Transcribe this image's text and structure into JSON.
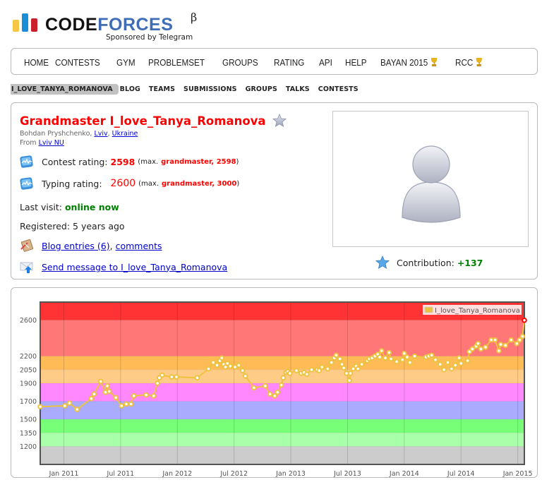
{
  "logo": {
    "word_part1": "CODE",
    "word_part2": "FORCES",
    "beta": "β",
    "sponsor": "Sponsored by Telegram"
  },
  "main_menu": [
    {
      "label": "HOME"
    },
    {
      "label": "CONTESTS"
    },
    {
      "label": "GYM"
    },
    {
      "label": "PROBLEMSET"
    },
    {
      "label": "GROUPS"
    },
    {
      "label": "RATING"
    },
    {
      "label": "API"
    },
    {
      "label": "HELP"
    },
    {
      "label": "BAYAN 2015",
      "icon": "trophy-icon"
    },
    {
      "label": "RCC",
      "icon": "trophy-icon"
    }
  ],
  "sub_menu": [
    {
      "label": "I_LOVE_TANYA_ROMANOVA",
      "active": true
    },
    {
      "label": "BLOG"
    },
    {
      "label": "TEAMS"
    },
    {
      "label": "SUBMISSIONS"
    },
    {
      "label": "GROUPS"
    },
    {
      "label": "TALKS"
    },
    {
      "label": "CONTESTS"
    }
  ],
  "profile": {
    "rank": "Grandmaster",
    "handle": "I_love_Tanya_Romanova",
    "handle_color": "#ff0000",
    "favorite_icon": "star-icon",
    "full_name": "Bohdan Pryshchenko",
    "city": "Lviv",
    "country": "Ukraine",
    "from_label": "From",
    "organization": "Lviv NU",
    "contest_rating": {
      "label": "Contest rating:",
      "value": "2598",
      "max_prefix": "(max.",
      "max_rank": "grandmaster, 2598",
      "max_suffix": ")",
      "icon": "rating-chart-icon"
    },
    "typing_rating": {
      "label": "Typing rating:",
      "value": "2600",
      "max_prefix": "(max.",
      "max_rank": "grandmaster, 3000",
      "max_suffix": ")",
      "icon": "rating-chart-icon"
    },
    "last_visit": {
      "label": "Last visit:",
      "value": "online now"
    },
    "registered": {
      "label": "Registered:",
      "value": "5 years ago"
    },
    "blog": {
      "entries_link": "Blog entries (6)",
      "separator": ",",
      "comments_link": "comments",
      "icon": "blog-icon"
    },
    "message": {
      "link": "Send message to I_love_Tanya_Romanova",
      "icon": "send-message-icon"
    },
    "avatar_icon": "user-avatar-icon",
    "contribution": {
      "label": "Contribution:",
      "value": "+137",
      "icon": "contribution-star-icon"
    }
  },
  "colors": {
    "grandmaster": "#ff0000",
    "online": "#008000",
    "link": "#0000cc",
    "series": "#edc240"
  },
  "chart_data": {
    "type": "line",
    "title": "",
    "xlabel": "",
    "ylabel": "",
    "legend": {
      "label": "I_love_Tanya_Romanova",
      "placement": "top-right"
    },
    "x_unit": "months since Jan 2011",
    "xlim": [
      -2.5,
      48.7
    ],
    "ylim": [
      1000,
      2800
    ],
    "x_ticks": [
      {
        "label": "Jan 2011",
        "value": 0
      },
      {
        "label": "Jul 2011",
        "value": 6
      },
      {
        "label": "Jan 2012",
        "value": 12
      },
      {
        "label": "Jul 2012",
        "value": 18
      },
      {
        "label": "Jan 2013",
        "value": 24
      },
      {
        "label": "Jul 2013",
        "value": 30
      },
      {
        "label": "Jan 2014",
        "value": 36
      },
      {
        "label": "Jul 2014",
        "value": 42
      },
      {
        "label": "Jan 2015",
        "value": 48
      }
    ],
    "y_ticks": [
      1200,
      1350,
      1500,
      1700,
      1900,
      2050,
      2200,
      2600
    ],
    "grid": true,
    "bands": [
      {
        "from": 2600,
        "to": 2800,
        "color": "#ff3333"
      },
      {
        "from": 2200,
        "to": 2600,
        "color": "#ff7777"
      },
      {
        "from": 2050,
        "to": 2200,
        "color": "#ffbb55"
      },
      {
        "from": 1900,
        "to": 2050,
        "color": "#ffcc88"
      },
      {
        "from": 1700,
        "to": 1900,
        "color": "#ff88ff"
      },
      {
        "from": 1500,
        "to": 1700,
        "color": "#aaaaff"
      },
      {
        "from": 1350,
        "to": 1500,
        "color": "#77ff77"
      },
      {
        "from": 1200,
        "to": 1350,
        "color": "#aaffaa"
      },
      {
        "from": 1000,
        "to": 1200,
        "color": "#cccccc"
      }
    ],
    "series": [
      {
        "name": "I_love_Tanya_Romanova",
        "color": "#edc240",
        "points": [
          [
            -2.5,
            1640
          ],
          [
            0.1,
            1650
          ],
          [
            0.6,
            1680
          ],
          [
            1.4,
            1610
          ],
          [
            2.9,
            1730
          ],
          [
            3.2,
            1780
          ],
          [
            3.9,
            1920
          ],
          [
            4.4,
            1800
          ],
          [
            4.6,
            1870
          ],
          [
            4.8,
            1810
          ],
          [
            5.5,
            1740
          ],
          [
            6.1,
            1650
          ],
          [
            6.6,
            1670
          ],
          [
            7.1,
            1670
          ],
          [
            7.4,
            1760
          ],
          [
            8.7,
            1770
          ],
          [
            9.5,
            1760
          ],
          [
            9.9,
            1900
          ],
          [
            10.1,
            1960
          ],
          [
            10.4,
            1990
          ],
          [
            11.4,
            1970
          ],
          [
            11.9,
            1970
          ],
          [
            14.1,
            1960
          ],
          [
            15.3,
            2060
          ],
          [
            15.8,
            2130
          ],
          [
            16.2,
            2100
          ],
          [
            16.5,
            2150
          ],
          [
            16.7,
            2180
          ],
          [
            16.9,
            2110
          ],
          [
            17.1,
            2080
          ],
          [
            17.3,
            2120
          ],
          [
            17.6,
            2090
          ],
          [
            18.1,
            2080
          ],
          [
            18.5,
            2100
          ],
          [
            18.9,
            2040
          ],
          [
            19.2,
            1980
          ],
          [
            20.1,
            1850
          ],
          [
            21.3,
            1870
          ],
          [
            21.8,
            1780
          ],
          [
            22.3,
            1760
          ],
          [
            22.6,
            1800
          ],
          [
            23.0,
            1880
          ],
          [
            23.2,
            1960
          ],
          [
            23.5,
            2020
          ],
          [
            23.7,
            2030
          ],
          [
            23.9,
            2010
          ],
          [
            24.6,
            2040
          ],
          [
            25.1,
            2010
          ],
          [
            25.4,
            2020
          ],
          [
            25.7,
            2000
          ],
          [
            26.2,
            2050
          ],
          [
            26.8,
            2050
          ],
          [
            27.0,
            2040
          ],
          [
            27.3,
            2080
          ],
          [
            27.9,
            2060
          ],
          [
            28.3,
            2130
          ],
          [
            28.6,
            2180
          ],
          [
            28.8,
            2210
          ],
          [
            29.2,
            2170
          ],
          [
            29.4,
            2110
          ],
          [
            29.6,
            2070
          ],
          [
            29.9,
            2010
          ],
          [
            30.2,
            1930
          ],
          [
            30.3,
            2010
          ],
          [
            30.6,
            2060
          ],
          [
            30.9,
            2090
          ],
          [
            31.1,
            2060
          ],
          [
            31.5,
            2110
          ],
          [
            32.1,
            2150
          ],
          [
            32.3,
            2170
          ],
          [
            32.6,
            2180
          ],
          [
            32.9,
            2200
          ],
          [
            33.2,
            2220
          ],
          [
            33.4,
            2190
          ],
          [
            33.6,
            2260
          ],
          [
            34.0,
            2180
          ],
          [
            34.4,
            2240
          ],
          [
            34.6,
            2170
          ],
          [
            35.2,
            2140
          ],
          [
            35.8,
            2160
          ],
          [
            36.0,
            2230
          ],
          [
            36.3,
            2190
          ],
          [
            36.6,
            2130
          ],
          [
            37.1,
            2200
          ],
          [
            38.3,
            2190
          ],
          [
            38.6,
            2200
          ],
          [
            38.9,
            2210
          ],
          [
            39.3,
            2160
          ],
          [
            39.8,
            2110
          ],
          [
            40.2,
            2050
          ],
          [
            40.6,
            2130
          ],
          [
            41.0,
            2060
          ],
          [
            41.4,
            2100
          ],
          [
            41.8,
            2180
          ],
          [
            42.0,
            2120
          ],
          [
            42.7,
            2150
          ],
          [
            42.9,
            2250
          ],
          [
            43.2,
            2280
          ],
          [
            43.6,
            2310
          ],
          [
            43.8,
            2340
          ],
          [
            44.1,
            2280
          ],
          [
            44.6,
            2300
          ],
          [
            45.2,
            2380
          ],
          [
            45.6,
            2380
          ],
          [
            46.0,
            2260
          ],
          [
            46.2,
            2330
          ],
          [
            46.7,
            2320
          ],
          [
            47.3,
            2380
          ],
          [
            47.9,
            2340
          ],
          [
            48.2,
            2380
          ],
          [
            48.5,
            2420
          ],
          [
            48.7,
            2598
          ]
        ],
        "last_point_color": "#ff0000"
      }
    ]
  }
}
